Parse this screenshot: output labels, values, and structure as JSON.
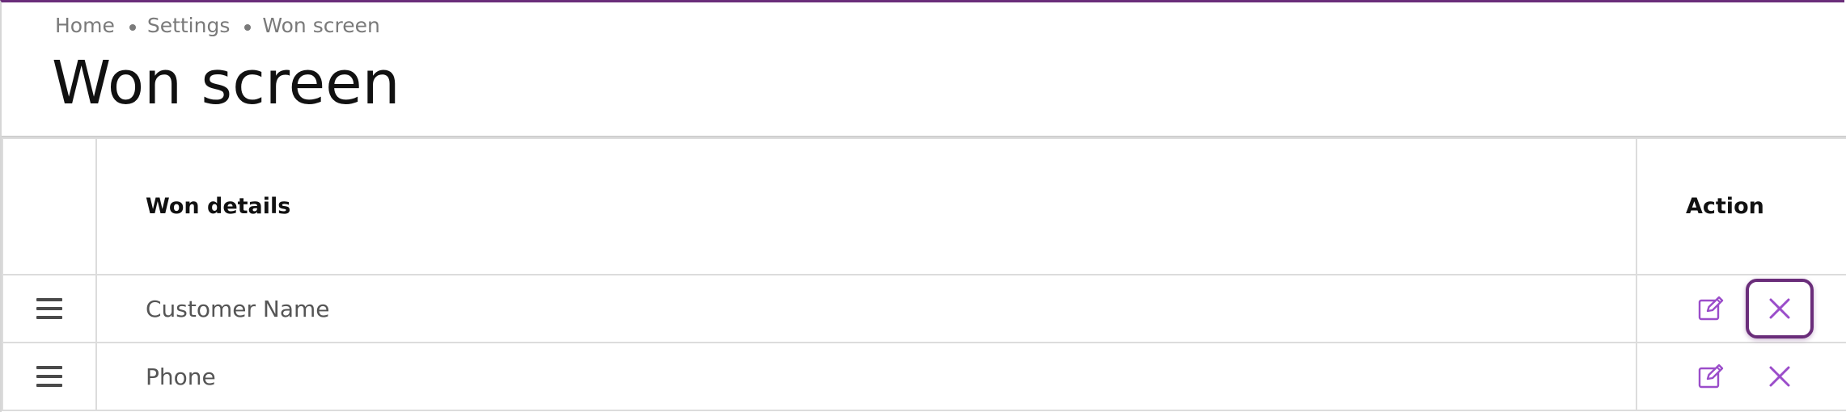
{
  "breadcrumb": {
    "items": [
      "Home",
      "Settings",
      "Won screen"
    ]
  },
  "page": {
    "title": "Won screen"
  },
  "table": {
    "headers": {
      "details": "Won details",
      "action": "Action"
    },
    "rows": [
      {
        "label": "Customer Name"
      },
      {
        "label": "Phone"
      }
    ]
  },
  "colors": {
    "accent": "#6a2d7a",
    "icon_purple": "#9b4dca"
  },
  "icons": {
    "drag": "drag-handle-icon",
    "edit": "edit-icon",
    "delete": "close-icon"
  }
}
